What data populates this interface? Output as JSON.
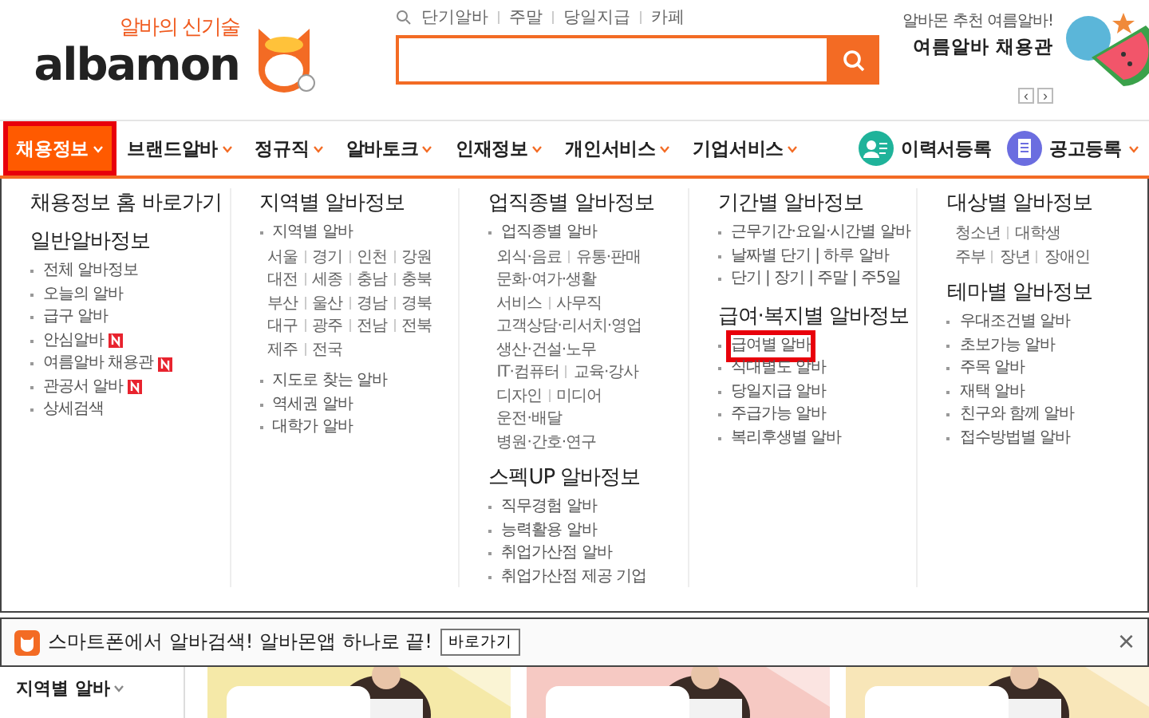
{
  "logo": {
    "tagline": "알바의 신기술",
    "wordmark": "albamon"
  },
  "quick_links": [
    "단기알바",
    "주말",
    "당일지급",
    "카페"
  ],
  "promo": {
    "subtitle": "알바몬 추천 여름알바!",
    "title": "여름알바 채용관",
    "prev": "‹",
    "next": "›"
  },
  "nav": {
    "items": [
      {
        "label": "채용정보",
        "selected": true
      },
      {
        "label": "브랜드알바",
        "selected": false
      },
      {
        "label": "정규직",
        "selected": false
      },
      {
        "label": "알바토크",
        "selected": false
      },
      {
        "label": "인재정보",
        "selected": false
      },
      {
        "label": "개인서비스",
        "selected": false
      },
      {
        "label": "기업서비스",
        "selected": false
      }
    ],
    "actions": [
      {
        "label": "이력서등록",
        "kind": "resume",
        "caret": false
      },
      {
        "label": "공고등록",
        "kind": "post",
        "caret": true
      }
    ]
  },
  "menu": {
    "columns": [
      {
        "sections": [
          {
            "title": "채용정보 홈 바로가기"
          },
          {
            "title": "일반알바정보",
            "items": [
              {
                "kind": "bullet",
                "text": "전체 알바정보",
                "new": false,
                "highlighted": false
              },
              {
                "kind": "bullet",
                "text": "오늘의 알바",
                "new": false,
                "highlighted": false
              },
              {
                "kind": "bullet",
                "text": "급구 알바",
                "new": false,
                "highlighted": false
              },
              {
                "kind": "bullet",
                "text": "안심알바",
                "new": true,
                "highlighted": false
              },
              {
                "kind": "bullet",
                "text": "여름알바 채용관",
                "new": true,
                "highlighted": false
              },
              {
                "kind": "bullet",
                "text": "관공서 알바",
                "new": true,
                "highlighted": false
              },
              {
                "kind": "bullet",
                "text": "상세검색",
                "new": false,
                "highlighted": false
              }
            ]
          }
        ]
      },
      {
        "sections": [
          {
            "title": "지역별 알바정보",
            "items": [
              {
                "kind": "bullet",
                "text": "지역별 알바",
                "new": false,
                "highlighted": false
              },
              {
                "kind": "links",
                "links": [
                  "서울",
                  "경기",
                  "인천",
                  "강원"
                ]
              },
              {
                "kind": "links",
                "links": [
                  "대전",
                  "세종",
                  "충남",
                  "충북"
                ]
              },
              {
                "kind": "links",
                "links": [
                  "부산",
                  "울산",
                  "경남",
                  "경북"
                ]
              },
              {
                "kind": "links",
                "links": [
                  "대구",
                  "광주",
                  "전남",
                  "전북"
                ]
              },
              {
                "kind": "links",
                "links": [
                  "제주",
                  "전국"
                ]
              },
              {
                "kind": "gap"
              },
              {
                "kind": "bullet",
                "text": "지도로 찾는 알바",
                "new": false,
                "highlighted": false
              },
              {
                "kind": "bullet",
                "text": "역세권 알바",
                "new": false,
                "highlighted": false
              },
              {
                "kind": "bullet",
                "text": "대학가 알바",
                "new": false,
                "highlighted": false
              }
            ]
          }
        ]
      },
      {
        "sections": [
          {
            "title": "업직종별 알바정보",
            "items": [
              {
                "kind": "bullet",
                "text": "업직종별 알바",
                "new": false,
                "highlighted": false
              },
              {
                "kind": "links",
                "links": [
                  "외식·음료",
                  "유통·판매"
                ]
              },
              {
                "kind": "links",
                "links": [
                  "문화·여가·생활"
                ]
              },
              {
                "kind": "links",
                "links": [
                  "서비스",
                  "사무직"
                ]
              },
              {
                "kind": "links",
                "links": [
                  "고객상담·리서치·영업"
                ]
              },
              {
                "kind": "links",
                "links": [
                  "생산·건설·노무"
                ]
              },
              {
                "kind": "links",
                "links": [
                  "IT·컴퓨터",
                  "교육·강사"
                ]
              },
              {
                "kind": "links",
                "links": [
                  "디자인",
                  "미디어"
                ]
              },
              {
                "kind": "links",
                "links": [
                  "운전·배달"
                ]
              },
              {
                "kind": "links",
                "links": [
                  "병원·간호·연구"
                ]
              }
            ]
          },
          {
            "title": "스펙UP 알바정보",
            "items": [
              {
                "kind": "bullet",
                "text": "직무경험 알바",
                "new": false,
                "highlighted": false
              },
              {
                "kind": "bullet",
                "text": "능력활용 알바",
                "new": false,
                "highlighted": false
              },
              {
                "kind": "bullet",
                "text": "취업가산점 알바",
                "new": false,
                "highlighted": false
              },
              {
                "kind": "bullet",
                "text": "취업가산점 제공 기업",
                "new": false,
                "highlighted": false
              }
            ]
          }
        ]
      },
      {
        "sections": [
          {
            "title": "기간별 알바정보",
            "items": [
              {
                "kind": "bullet",
                "text": "근무기간·요일·시간별 알바",
                "new": false,
                "highlighted": false
              },
              {
                "kind": "bullet",
                "text": "날짜별 단기 | 하루 알바",
                "new": false,
                "highlighted": false
              },
              {
                "kind": "bullet",
                "text": "단기 | 장기 | 주말 | 주5일",
                "new": false,
                "highlighted": false
              }
            ]
          },
          {
            "title": "급여·복지별 알바정보",
            "items": [
              {
                "kind": "bullet",
                "text": "급여별 알바",
                "new": false,
                "highlighted": true
              },
              {
                "kind": "bullet",
                "text": "식대별도 알바",
                "new": false,
                "highlighted": false
              },
              {
                "kind": "bullet",
                "text": "당일지급 알바",
                "new": false,
                "highlighted": false
              },
              {
                "kind": "bullet",
                "text": "주급가능 알바",
                "new": false,
                "highlighted": false
              },
              {
                "kind": "bullet",
                "text": "복리후생별 알바",
                "new": false,
                "highlighted": false
              }
            ]
          }
        ]
      },
      {
        "sections": [
          {
            "title": "대상별 알바정보",
            "items": [
              {
                "kind": "links",
                "links": [
                  "청소년",
                  "대학생"
                ]
              },
              {
                "kind": "links",
                "links": [
                  "주부",
                  "장년",
                  "장애인"
                ]
              }
            ]
          },
          {
            "title": "테마별 알바정보",
            "items": [
              {
                "kind": "bullet",
                "text": "우대조건별 알바",
                "new": false,
                "highlighted": false
              },
              {
                "kind": "bullet",
                "text": "초보가능 알바",
                "new": false,
                "highlighted": false
              },
              {
                "kind": "bullet",
                "text": "주목 알바",
                "new": false,
                "highlighted": false
              },
              {
                "kind": "bullet",
                "text": "재택 알바",
                "new": false,
                "highlighted": false
              },
              {
                "kind": "bullet",
                "text": "친구와 함께 알바",
                "new": false,
                "highlighted": false
              },
              {
                "kind": "bullet",
                "text": "접수방법별 알바",
                "new": false,
                "highlighted": false
              }
            ]
          }
        ]
      }
    ]
  },
  "app_banner": {
    "text": "스마트폰에서 알바검색! 알바몬앱 하나로 끝!",
    "button": "바로가기",
    "close": "×"
  },
  "region_panel": {
    "title": "지역별 알바"
  },
  "banners": [
    {
      "kind": "picture"
    },
    {
      "kind": "picture"
    },
    {
      "kind": "picture"
    }
  ]
}
